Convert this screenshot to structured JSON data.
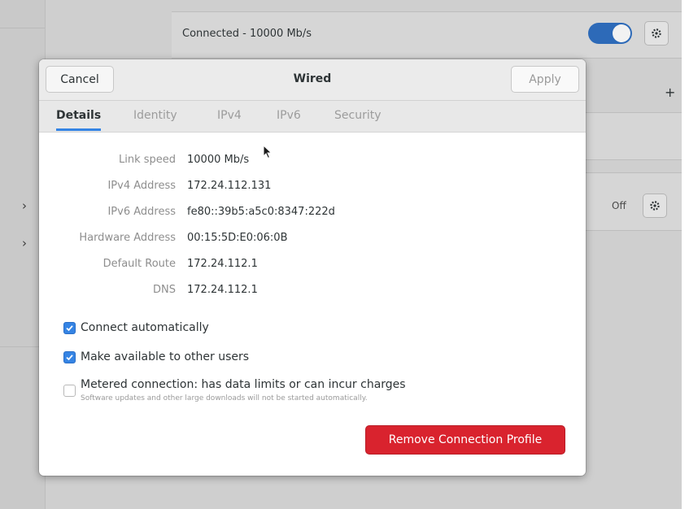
{
  "background": {
    "connected_text": "Connected - 10000 Mb/s",
    "off_text": "Off",
    "plus_symbol": "+",
    "chevron_symbol": "›"
  },
  "dialog": {
    "title": "Wired",
    "cancel_label": "Cancel",
    "apply_label": "Apply",
    "tabs": [
      {
        "label": "Details",
        "active": true
      },
      {
        "label": "Identity",
        "active": false
      },
      {
        "label": "IPv4",
        "active": false
      },
      {
        "label": "IPv6",
        "active": false
      },
      {
        "label": "Security",
        "active": false
      }
    ],
    "details": [
      {
        "label": "Link speed",
        "value": "10000 Mb/s"
      },
      {
        "label": "IPv4 Address",
        "value": "172.24.112.131"
      },
      {
        "label": "IPv6 Address",
        "value": "fe80::39b5:a5c0:8347:222d"
      },
      {
        "label": "Hardware Address",
        "value": "00:15:5D:E0:06:0B"
      },
      {
        "label": "Default Route",
        "value": "172.24.112.1"
      },
      {
        "label": "DNS",
        "value": "172.24.112.1"
      }
    ],
    "options": {
      "connect_automatically": {
        "label": "Connect automatically",
        "checked": true
      },
      "available_to_others": {
        "label": "Make available to other users",
        "checked": true
      },
      "metered": {
        "label": "Metered connection: has data limits or can incur charges",
        "sublabel": "Software updates and other large downloads will not be started automatically.",
        "checked": false
      }
    },
    "remove_label": "Remove Connection Profile"
  },
  "colors": {
    "accent": "#3584e4",
    "toggle": "#2d6ab8",
    "destructive": "#d9232e"
  },
  "icons": [
    "gear-icon",
    "chevron-right-icon",
    "checkmark-icon",
    "pointer-cursor-icon",
    "plus-icon"
  ]
}
